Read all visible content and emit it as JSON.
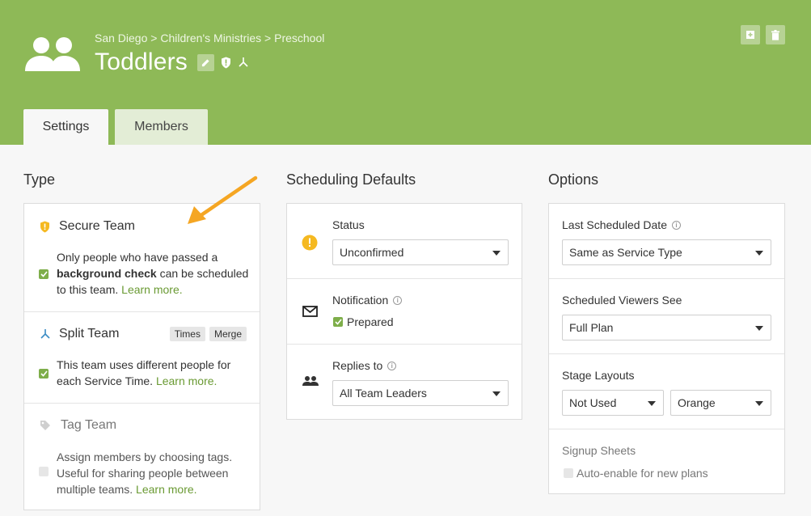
{
  "header": {
    "breadcrumb": "San Diego > Children's Ministries > Preschool",
    "title": "Toddlers",
    "icons": [
      "team-avatar-icon",
      "pencil-icon",
      "shield-icon",
      "split-icon",
      "archive-icon",
      "trash-icon"
    ]
  },
  "tabs": [
    {
      "label": "Settings",
      "active": true
    },
    {
      "label": "Members",
      "active": false
    }
  ],
  "type": {
    "title": "Type",
    "secure": {
      "label": "Secure Team",
      "desc_start": "Only people who have passed a",
      "desc_bold": "background check",
      "desc_mid": "can be scheduled",
      "desc_end": "to this team.",
      "link": "Learn more.",
      "checked": true
    },
    "split": {
      "label": "Split Team",
      "pill_times": "Times",
      "pill_merge": "Merge",
      "desc_line1": "This team uses different people for",
      "desc_line2": "each Service Time.",
      "link": "Learn more.",
      "checked": true
    },
    "tag": {
      "label": "Tag Team",
      "desc_line1": "Assign members by choosing tags.",
      "desc_line2": "Useful for sharing people between",
      "desc_line3": "multiple teams.",
      "link": "Learn more.",
      "checked": false
    }
  },
  "scheduling": {
    "title": "Scheduling Defaults",
    "status_label": "Status",
    "status_value": "Unconfirmed",
    "notification_label": "Notification",
    "notification_option": "Prepared",
    "notification_checked": true,
    "replies_label": "Replies to",
    "replies_value": "All Team Leaders"
  },
  "options": {
    "title": "Options",
    "last_scheduled_label": "Last Scheduled Date",
    "last_scheduled_value": "Same as Service Type",
    "viewers_label": "Scheduled Viewers See",
    "viewers_value": "Full Plan",
    "stage_label": "Stage Layouts",
    "stage_value": "Not Used",
    "stage_color_value": "Orange",
    "signup_label": "Signup Sheets",
    "signup_option": "Auto-enable for new plans",
    "signup_checked": false
  },
  "colors": {
    "header_green": "#8eb957",
    "link_green": "#6a9a33",
    "warning_yellow": "#f5b921",
    "arrow_orange": "#f5a623"
  }
}
